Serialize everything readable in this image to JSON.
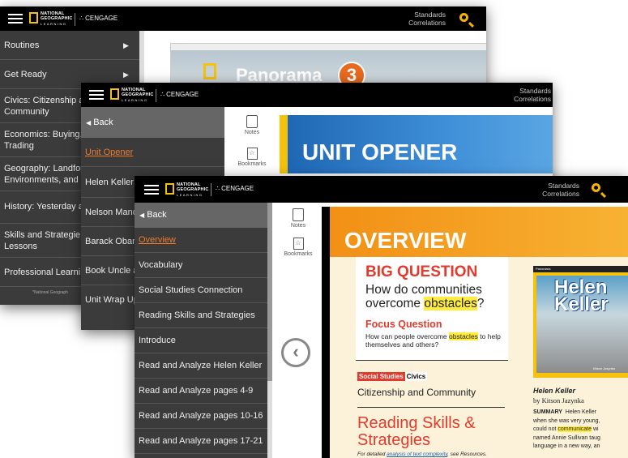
{
  "header": {
    "brand_line1": "NATIONAL",
    "brand_line2": "GEOGRAPHIC",
    "brand_sub": "LEARNING",
    "partner": "CENGAGE",
    "standards_line1": "Standards",
    "standards_line2": "Correlations"
  },
  "window1": {
    "sidebar": [
      "Routines",
      "Get Ready",
      "Civics: Citizenship and Community",
      "Economics: Buying, Selling, and Trading",
      "Geography: Landforms, Environments, and Communities",
      "History: Yesterday and Today",
      "Skills and Strategies Lessons",
      "Professional Learning"
    ],
    "sidebar_visible": [
      "Routines",
      "Get Ready",
      "Civics: Citizenship a",
      "Community",
      "Economics: Buying,",
      "Trading",
      "Geography: Landfor",
      "Environments, and",
      "History: Yesterday a",
      "Skills and Strategie",
      "Lessons",
      "Professional Learni"
    ],
    "footnote": "*National Geograph",
    "book_title": "Panorama",
    "book_number": "3"
  },
  "window2": {
    "back": "Back",
    "sidebar": [
      "Unit Opener",
      "Helen Keller",
      "Nelson Mand",
      "Barack Obam",
      "Book Uncle a",
      "Unit Wrap Up"
    ],
    "tools": {
      "notes": "Notes",
      "bookmarks": "Bookmarks"
    },
    "page_title": "UNIT OPENER"
  },
  "window3": {
    "back": "Back",
    "sidebar": [
      "Overview",
      "Vocabulary",
      "Social Studies Connection",
      "Reading Skills and Strategies",
      "Introduce",
      "Read and Analyze Helen Keller",
      "Read and Analyze pages 4-9",
      "Read and Analyze pages 10-16",
      "Read and Analyze pages 17-21"
    ],
    "tools": {
      "notes": "Notes",
      "bookmarks": "Bookmarks"
    },
    "page": {
      "title": "OVERVIEW",
      "big_question_label": "BIG QUESTION",
      "big_question_pre": "How do communities overcome ",
      "big_question_highlight": "obstacles",
      "big_question_post": "?",
      "focus_label": "Focus Question",
      "focus_pre": "How can people overcome ",
      "focus_highlight": "obstacles",
      "focus_post": " to help themselves and others?",
      "ss_tag1": "Social Studies",
      "ss_tag2": "Civics",
      "ss_text": "Citizenship and Community",
      "reading_title": "Reading Skills & Strategies",
      "reading_note_pre": "For detailed ",
      "reading_note_link": "analysis of text complexity",
      "reading_note_post": ", see Resources.",
      "book_cover_title1": "Helen",
      "book_cover_title2": "Keller",
      "book_cover_author": "Kitson Jazynka",
      "book_series": "Panorama",
      "book_title": "Helen Keller",
      "book_author": "by Kitson Jazynka",
      "summary_label": "SUMMARY",
      "summary_l1": "Helen Keller",
      "summary_l2": "when she was very young,",
      "summary_l3_pre": "could not ",
      "summary_l3_hl": "communicate",
      "summary_l3_post": " wi",
      "summary_l4": "named Annie Sullivan taug",
      "summary_l5": "language in a new way, an"
    }
  },
  "colors": {
    "accent": "#f4b400",
    "orange": "#f07a2b",
    "sidebar": "#3b3b3b",
    "header": "#000000",
    "red": "#e23a2c"
  }
}
